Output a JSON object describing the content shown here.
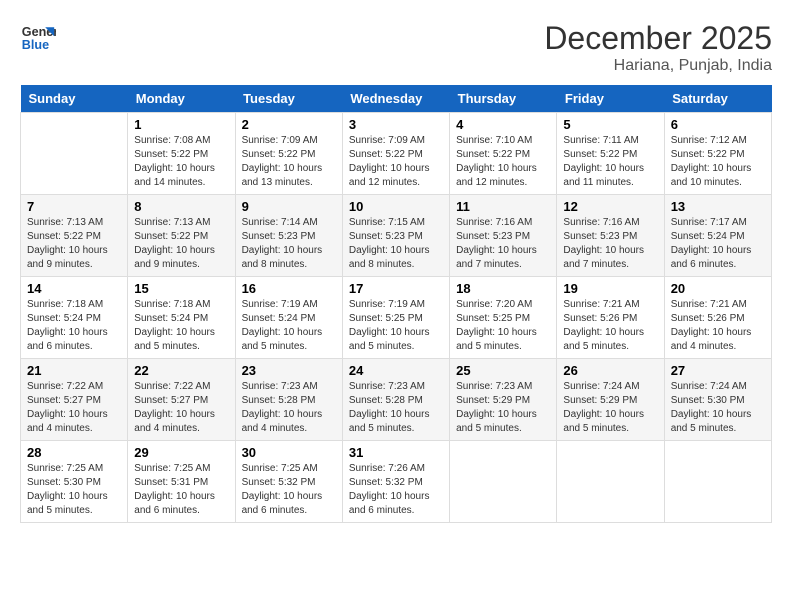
{
  "header": {
    "logo_line1": "General",
    "logo_line2": "Blue",
    "month": "December 2025",
    "location": "Hariana, Punjab, India"
  },
  "weekdays": [
    "Sunday",
    "Monday",
    "Tuesday",
    "Wednesday",
    "Thursday",
    "Friday",
    "Saturday"
  ],
  "weeks": [
    [
      {
        "day": "",
        "info": ""
      },
      {
        "day": "1",
        "info": "Sunrise: 7:08 AM\nSunset: 5:22 PM\nDaylight: 10 hours and 14 minutes."
      },
      {
        "day": "2",
        "info": "Sunrise: 7:09 AM\nSunset: 5:22 PM\nDaylight: 10 hours and 13 minutes."
      },
      {
        "day": "3",
        "info": "Sunrise: 7:09 AM\nSunset: 5:22 PM\nDaylight: 10 hours and 12 minutes."
      },
      {
        "day": "4",
        "info": "Sunrise: 7:10 AM\nSunset: 5:22 PM\nDaylight: 10 hours and 12 minutes."
      },
      {
        "day": "5",
        "info": "Sunrise: 7:11 AM\nSunset: 5:22 PM\nDaylight: 10 hours and 11 minutes."
      },
      {
        "day": "6",
        "info": "Sunrise: 7:12 AM\nSunset: 5:22 PM\nDaylight: 10 hours and 10 minutes."
      }
    ],
    [
      {
        "day": "7",
        "info": "Sunrise: 7:13 AM\nSunset: 5:22 PM\nDaylight: 10 hours and 9 minutes."
      },
      {
        "day": "8",
        "info": "Sunrise: 7:13 AM\nSunset: 5:22 PM\nDaylight: 10 hours and 9 minutes."
      },
      {
        "day": "9",
        "info": "Sunrise: 7:14 AM\nSunset: 5:23 PM\nDaylight: 10 hours and 8 minutes."
      },
      {
        "day": "10",
        "info": "Sunrise: 7:15 AM\nSunset: 5:23 PM\nDaylight: 10 hours and 8 minutes."
      },
      {
        "day": "11",
        "info": "Sunrise: 7:16 AM\nSunset: 5:23 PM\nDaylight: 10 hours and 7 minutes."
      },
      {
        "day": "12",
        "info": "Sunrise: 7:16 AM\nSunset: 5:23 PM\nDaylight: 10 hours and 7 minutes."
      },
      {
        "day": "13",
        "info": "Sunrise: 7:17 AM\nSunset: 5:24 PM\nDaylight: 10 hours and 6 minutes."
      }
    ],
    [
      {
        "day": "14",
        "info": "Sunrise: 7:18 AM\nSunset: 5:24 PM\nDaylight: 10 hours and 6 minutes."
      },
      {
        "day": "15",
        "info": "Sunrise: 7:18 AM\nSunset: 5:24 PM\nDaylight: 10 hours and 5 minutes."
      },
      {
        "day": "16",
        "info": "Sunrise: 7:19 AM\nSunset: 5:24 PM\nDaylight: 10 hours and 5 minutes."
      },
      {
        "day": "17",
        "info": "Sunrise: 7:19 AM\nSunset: 5:25 PM\nDaylight: 10 hours and 5 minutes."
      },
      {
        "day": "18",
        "info": "Sunrise: 7:20 AM\nSunset: 5:25 PM\nDaylight: 10 hours and 5 minutes."
      },
      {
        "day": "19",
        "info": "Sunrise: 7:21 AM\nSunset: 5:26 PM\nDaylight: 10 hours and 5 minutes."
      },
      {
        "day": "20",
        "info": "Sunrise: 7:21 AM\nSunset: 5:26 PM\nDaylight: 10 hours and 4 minutes."
      }
    ],
    [
      {
        "day": "21",
        "info": "Sunrise: 7:22 AM\nSunset: 5:27 PM\nDaylight: 10 hours and 4 minutes."
      },
      {
        "day": "22",
        "info": "Sunrise: 7:22 AM\nSunset: 5:27 PM\nDaylight: 10 hours and 4 minutes."
      },
      {
        "day": "23",
        "info": "Sunrise: 7:23 AM\nSunset: 5:28 PM\nDaylight: 10 hours and 4 minutes."
      },
      {
        "day": "24",
        "info": "Sunrise: 7:23 AM\nSunset: 5:28 PM\nDaylight: 10 hours and 5 minutes."
      },
      {
        "day": "25",
        "info": "Sunrise: 7:23 AM\nSunset: 5:29 PM\nDaylight: 10 hours and 5 minutes."
      },
      {
        "day": "26",
        "info": "Sunrise: 7:24 AM\nSunset: 5:29 PM\nDaylight: 10 hours and 5 minutes."
      },
      {
        "day": "27",
        "info": "Sunrise: 7:24 AM\nSunset: 5:30 PM\nDaylight: 10 hours and 5 minutes."
      }
    ],
    [
      {
        "day": "28",
        "info": "Sunrise: 7:25 AM\nSunset: 5:30 PM\nDaylight: 10 hours and 5 minutes."
      },
      {
        "day": "29",
        "info": "Sunrise: 7:25 AM\nSunset: 5:31 PM\nDaylight: 10 hours and 6 minutes."
      },
      {
        "day": "30",
        "info": "Sunrise: 7:25 AM\nSunset: 5:32 PM\nDaylight: 10 hours and 6 minutes."
      },
      {
        "day": "31",
        "info": "Sunrise: 7:26 AM\nSunset: 5:32 PM\nDaylight: 10 hours and 6 minutes."
      },
      {
        "day": "",
        "info": ""
      },
      {
        "day": "",
        "info": ""
      },
      {
        "day": "",
        "info": ""
      }
    ]
  ]
}
